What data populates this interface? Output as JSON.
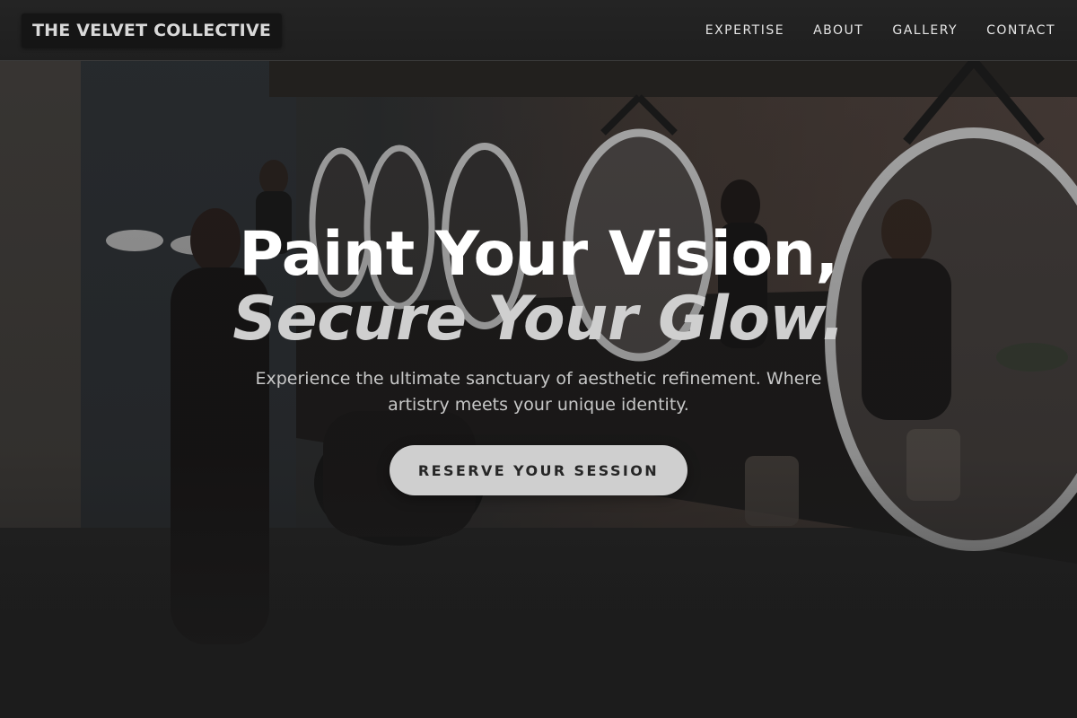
{
  "brand": {
    "name": "THE VELVET COLLECTIVE"
  },
  "nav": {
    "items": [
      {
        "label": "EXPERTISE"
      },
      {
        "label": "ABOUT"
      },
      {
        "label": "GALLERY"
      },
      {
        "label": "CONTACT"
      }
    ]
  },
  "hero": {
    "headline_line1": "Paint Your Vision,",
    "headline_line2": "Secure Your Glow.",
    "subtitle": "Experience the ultimate sanctuary of aesthetic refinement. Where artistry meets your unique identity.",
    "cta_label": "RESERVE YOUR SESSION"
  },
  "colors": {
    "header_bg": "#222222",
    "cta_bg": "#cfcfcf",
    "cta_text": "#262626",
    "headline_secondary": "#cfcfcf"
  }
}
